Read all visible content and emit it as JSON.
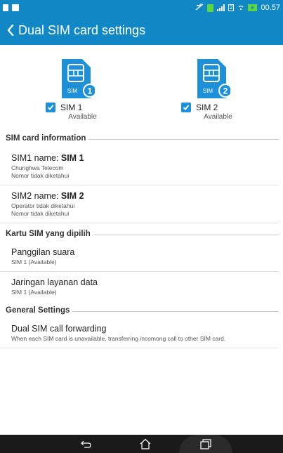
{
  "status_bar": {
    "time": "00.57",
    "icons": [
      "document-icon",
      "image-icon",
      "mute-icon",
      "sim-icon",
      "signal-icon",
      "sim2-icon",
      "wifi-icon",
      "battery-charging-icon"
    ],
    "sim2_label": "2"
  },
  "app_bar": {
    "title": "Dual SIM card settings"
  },
  "sims": [
    {
      "label": "SIM 1",
      "status": "Available",
      "checked": true,
      "badge": "1",
      "card_text": "SIM"
    },
    {
      "label": "SIM 2",
      "status": "Available",
      "checked": true,
      "badge": "2",
      "card_text": "SIM"
    }
  ],
  "sections": {
    "sim_info": "SIM card information",
    "preferred": "Kartu SIM yang dipilih",
    "general": "General Settings"
  },
  "sim_info_items": [
    {
      "name_label": "SIM1 name: ",
      "name_value": "SIM 1",
      "line1": "Chunghwa Telecom",
      "line2": "Nomor tidak diketahui"
    },
    {
      "name_label": "SIM2 name: ",
      "name_value": "SIM 2",
      "line1": "Operator tidak diketahui",
      "line2": "Nomor tidak diketahui"
    }
  ],
  "preferred_items": [
    {
      "title": "Panggilan suara",
      "sub": "SIM 1 (Available)"
    },
    {
      "title": "Jaringan layanan data",
      "sub": "SIM 1 (Available)"
    }
  ],
  "general_items": [
    {
      "title": "Dual SIM call forwarding",
      "sub": "When each SIM card is unavailable, transferring incomong call to other SIM card."
    }
  ],
  "colors": {
    "accent": "#1187c6",
    "checkbox": "#1e90d8",
    "nav_background": "#1a1a1a"
  }
}
